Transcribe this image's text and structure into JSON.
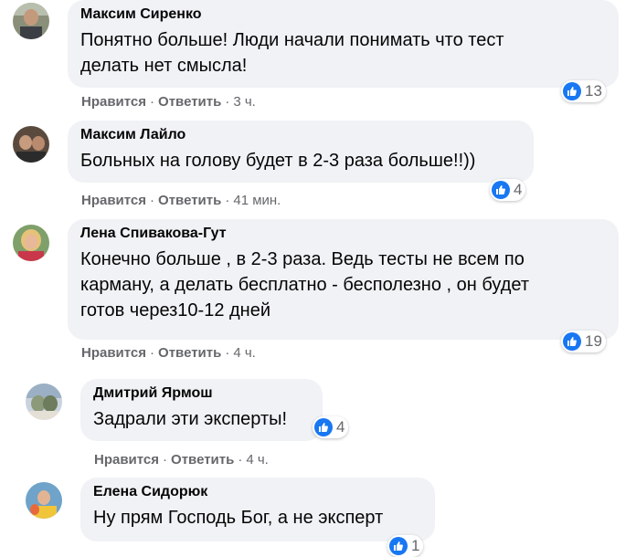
{
  "comments": [
    {
      "author": "Максим Сиренко",
      "lines": [
        "Понятно больше! Люди начали понимать что тест",
        "делать нет смысла!"
      ],
      "like": "Нравится",
      "reply": "Ответить",
      "time": "3 ч.",
      "reactions": "13"
    },
    {
      "author": "Максим Лайло",
      "lines": [
        "Больных на голову будет в 2-3 раза больше!!))"
      ],
      "like": "Нравится",
      "reply": "Ответить",
      "time": "41 мин.",
      "reactions": "4"
    },
    {
      "author": "Лена Спивакова-Гут",
      "lines": [
        "Конечно больше , в 2-3 раза. Ведь тесты не всем по",
        "карману, а делать бесплатно - бесполезно , он будет",
        "готов через10-12 дней"
      ],
      "like": "Нравится",
      "reply": "Ответить",
      "time": "4 ч.",
      "reactions": "19"
    },
    {
      "author": "Дмитрий Ярмош",
      "lines": [
        "Задрали эти эксперты!"
      ],
      "like": "Нравится",
      "reply": "Ответить",
      "time": "4 ч.",
      "reactions": "4"
    },
    {
      "author": "Елена Сидорюк",
      "lines": [
        "Ну прям Господь Бог, а не эксперт"
      ],
      "like": "",
      "reply": "",
      "time": "",
      "reactions": "1"
    }
  ]
}
